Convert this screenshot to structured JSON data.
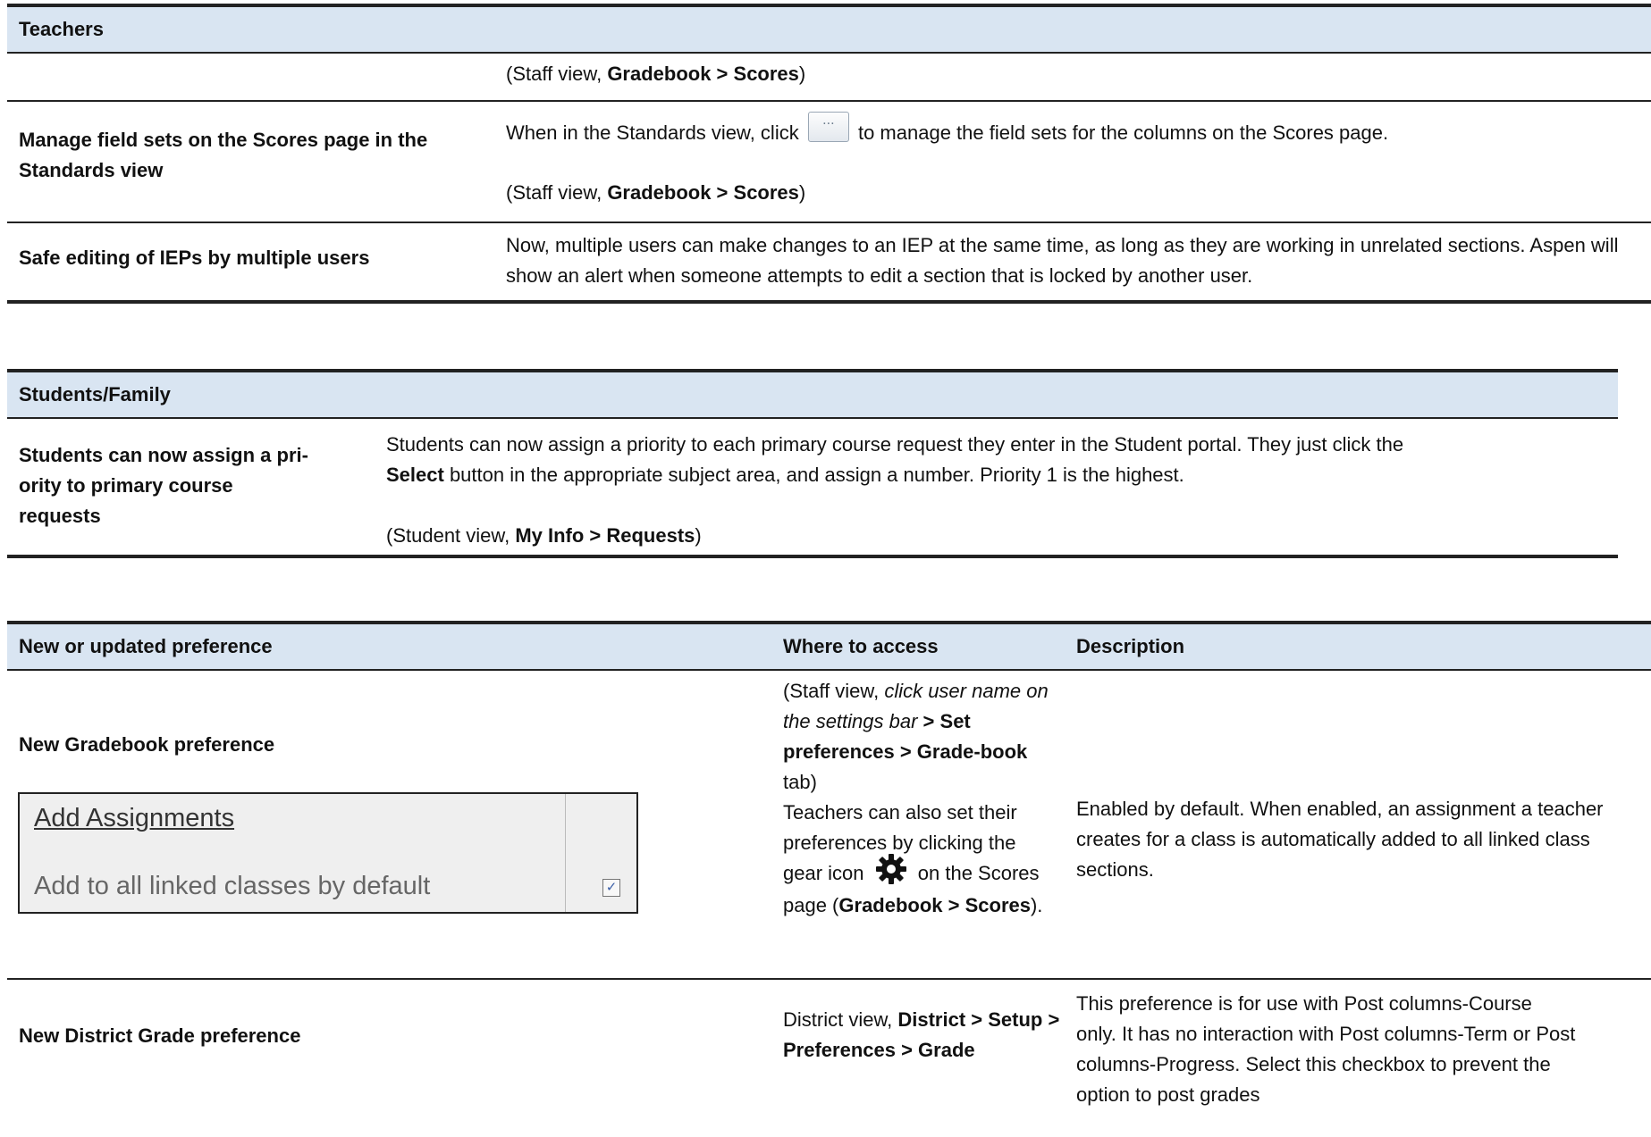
{
  "teachers": {
    "header": "Teachers",
    "rows": [
      {
        "label": "",
        "access": "(Staff view, ",
        "access_bold": "Gradebook > Scores",
        "access_end": ")"
      },
      {
        "label": "Manage field sets on the Scores page in the Standards view",
        "desc_before": "When in the Standards view, click",
        "button_label": "...",
        "desc_after": "to manage the field sets for the columns on the Scores page.",
        "access": "(Staff view, ",
        "access_bold": "Gradebook > Scores",
        "access_end": ")"
      },
      {
        "label": "Safe editing of IEPs by multiple users",
        "desc": "Now, multiple users can make changes to an IEP at the same time, as long as they are working in unrelated sections. Aspen will show an alert when someone attempts to edit a section that is locked by another user."
      }
    ]
  },
  "students": {
    "header": "Students/Family",
    "rows": [
      {
        "label_1": "Students can now assign a pri-",
        "label_2": "ority to primary course",
        "label_3": "requests",
        "desc_1": "Students can now assign a priority to each primary course request they enter in the Student portal. They just click the",
        "desc_bold": "Select",
        "desc_2": " button in the appropriate subject area, and assign a number. Priority 1 is the highest.",
        "access": "(Student view, ",
        "access_bold": "My Info > Requests",
        "access_end": ")"
      }
    ]
  },
  "preferences": {
    "columns": [
      "New or updated preference",
      "Where to access",
      "Description"
    ],
    "rows": [
      {
        "name": "New Gradebook preference",
        "panel": {
          "link": "Add Assignments",
          "checkbox_label": "Add to all linked classes by default",
          "checked": true
        },
        "access_1": "(Staff view, ",
        "access_italic": "click user name on the settings bar",
        "access_2": " > ",
        "access_bold": "Set preferences > Grade-book",
        "access_3": " tab)",
        "access_extra_1": "Teachers can also set their preferences by clicking the gear icon",
        "access_extra_2": "on the Scores page (",
        "access_extra_bold": "Gradebook > Scores",
        "access_extra_3": ").",
        "desc": "Enabled by default. When enabled, an assignment a teacher creates for a class is automatically added to all linked class sections."
      },
      {
        "name": "New District Grade preference",
        "access_1": "District view, ",
        "access_bold": "District > Setup > Preferences > Grade",
        "desc": "This preference is for use with Post columns-Course only. It has no interaction with Post columns-Term or Post columns-Progress. Select this checkbox to prevent the option to post grades"
      }
    ]
  }
}
